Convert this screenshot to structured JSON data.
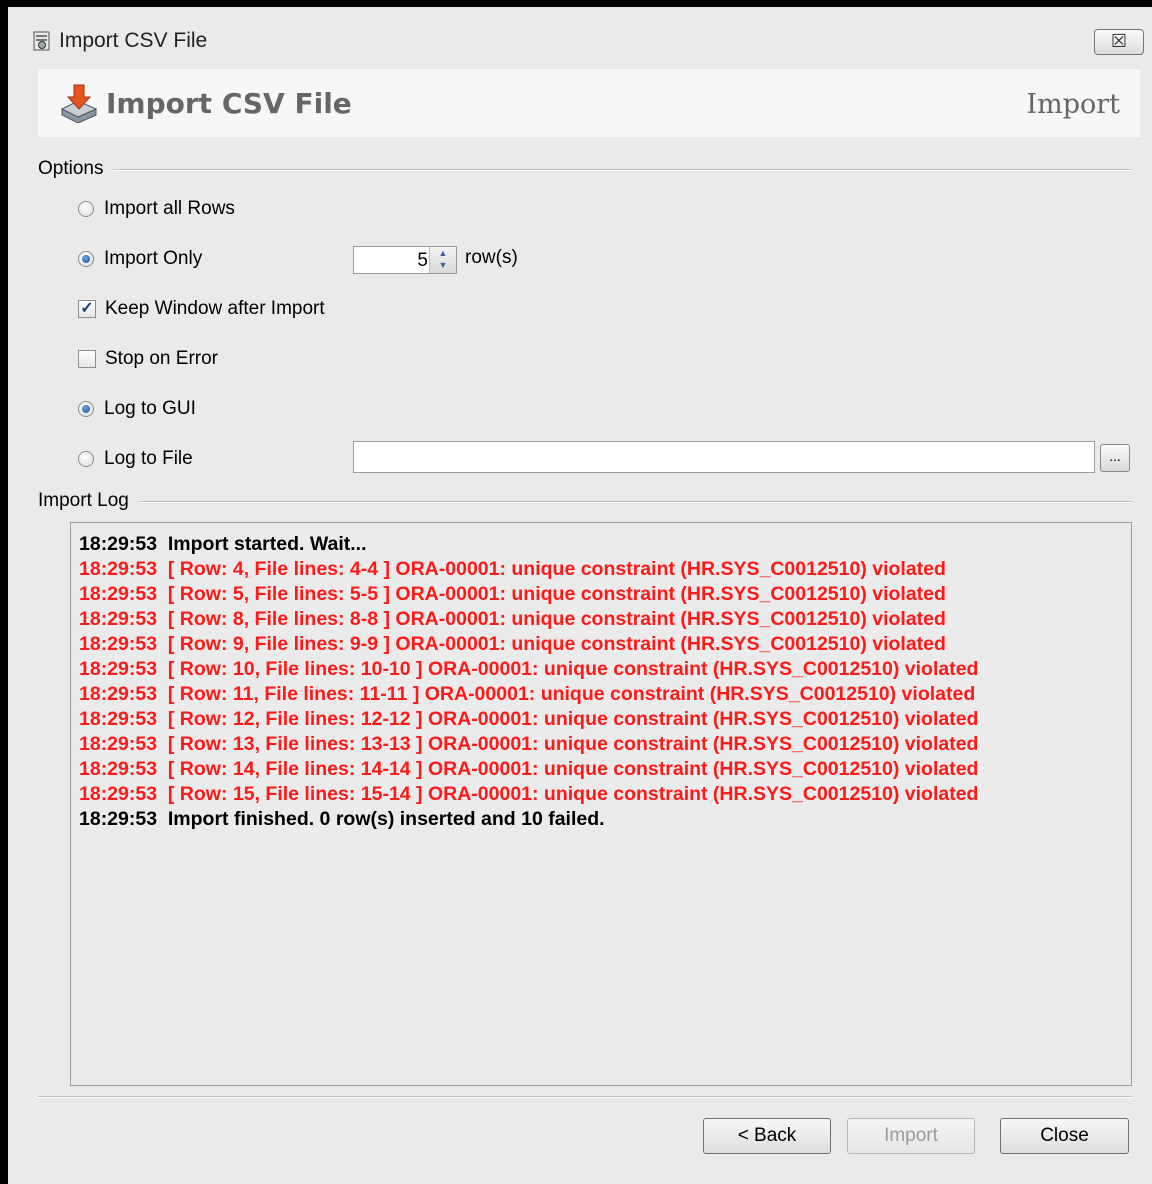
{
  "window": {
    "title": "Import CSV File",
    "close_glyph": "☒"
  },
  "header": {
    "title": "Import CSV File",
    "step": "Import",
    "icon": "import-icon"
  },
  "options": {
    "section_label": "Options",
    "import_all_rows": "Import all Rows",
    "import_only": "Import Only",
    "import_only_count": "5",
    "rows_suffix": "row(s)",
    "keep_window": "Keep Window after Import",
    "stop_on_error": "Stop on Error",
    "log_to_gui": "Log to GUI",
    "log_to_file": "Log to File",
    "log_file_path": "",
    "browse_label": "..."
  },
  "import_log": {
    "section_label": "Import Log",
    "lines": [
      {
        "text": "18:29:53  Import started. Wait...",
        "type": "ok"
      },
      {
        "text": "18:29:53  [ Row: 4, File lines: 4-4 ] ORA-00001: unique constraint (HR.SYS_C0012510) violated",
        "type": "err"
      },
      {
        "text": "18:29:53  [ Row: 5, File lines: 5-5 ] ORA-00001: unique constraint (HR.SYS_C0012510) violated",
        "type": "err"
      },
      {
        "text": "18:29:53  [ Row: 8, File lines: 8-8 ] ORA-00001: unique constraint (HR.SYS_C0012510) violated",
        "type": "err"
      },
      {
        "text": "18:29:53  [ Row: 9, File lines: 9-9 ] ORA-00001: unique constraint (HR.SYS_C0012510) violated",
        "type": "err"
      },
      {
        "text": "18:29:53  [ Row: 10, File lines: 10-10 ] ORA-00001: unique constraint (HR.SYS_C0012510) violated",
        "type": "err"
      },
      {
        "text": "18:29:53  [ Row: 11, File lines: 11-11 ] ORA-00001: unique constraint (HR.SYS_C0012510) violated",
        "type": "err"
      },
      {
        "text": "18:29:53  [ Row: 12, File lines: 12-12 ] ORA-00001: unique constraint (HR.SYS_C0012510) violated",
        "type": "err"
      },
      {
        "text": "18:29:53  [ Row: 13, File lines: 13-13 ] ORA-00001: unique constraint (HR.SYS_C0012510) violated",
        "type": "err"
      },
      {
        "text": "18:29:53  [ Row: 14, File lines: 14-14 ] ORA-00001: unique constraint (HR.SYS_C0012510) violated",
        "type": "err"
      },
      {
        "text": "18:29:53  [ Row: 15, File lines: 15-14 ] ORA-00001: unique constraint (HR.SYS_C0012510) violated",
        "type": "err"
      },
      {
        "text": "18:29:53  Import finished. 0 row(s) inserted and 10 failed.",
        "type": "ok"
      }
    ]
  },
  "buttons": {
    "back": "< Back",
    "import": "Import",
    "close": "Close"
  },
  "colors": {
    "error": "#ff1a1a",
    "background": "#ece9e9"
  }
}
